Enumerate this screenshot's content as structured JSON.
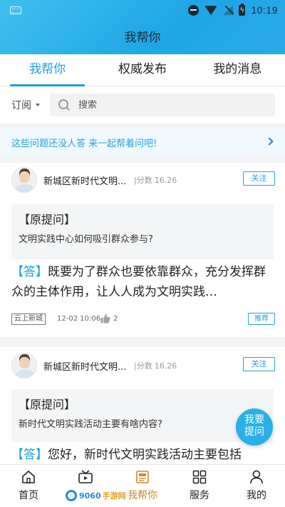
{
  "status_bar": {
    "time": "10:19"
  },
  "page_title": "我帮你",
  "tabs": [
    {
      "label": "我帮你",
      "active": true
    },
    {
      "label": "权威发布",
      "active": false
    },
    {
      "label": "我的消息",
      "active": false
    }
  ],
  "search": {
    "subscribe_label": "订阅",
    "placeholder": "搜索"
  },
  "banner": {
    "text": "这些问题还没人答 来一起帮着问吧!"
  },
  "posts": [
    {
      "author": "新城区新时代文明...",
      "score_label": "分数",
      "score": "16.26",
      "follow_label": "关注",
      "original_label": "【原提问】",
      "original_question": "文明实践中心如何吸引群众参与?",
      "answer_tag": "【答】",
      "answer_text": "既要为了群众也要依靠群众，充分发挥群众的主体作用，让人人成为文明实践…",
      "source": "云上新城",
      "time": "12-02 10:06",
      "likes": "2",
      "recommend_label": "推荐"
    },
    {
      "author": "新城区新时代文明...",
      "score_label": "分数",
      "score": "16.26",
      "follow_label": "关注",
      "original_label": "【原提问】",
      "original_question": "新时代文明实践活动主要有啥内容?",
      "answer_tag": "【答】",
      "answer_text": "您好，新时代文明实践活动主要包括"
    }
  ],
  "fab": {
    "line1": "我要",
    "line2": "提问"
  },
  "bottom_nav": [
    {
      "label": "首页",
      "icon": "home-icon",
      "active": false
    },
    {
      "label": "",
      "icon": "video-icon",
      "active": false
    },
    {
      "label": "我帮你",
      "icon": "help-icon",
      "active": true
    },
    {
      "label": "服务",
      "icon": "grid-icon",
      "active": false
    },
    {
      "label": "我的",
      "icon": "person-icon",
      "active": false
    }
  ],
  "watermark": {
    "text": "9060",
    "accent_text": "手游网"
  },
  "colors": {
    "accent": "#1ba0e2",
    "header_gradient_start": "#3fc0ef",
    "header_gradient_end": "#2aa9e8",
    "active_nav": "#c98a2a"
  }
}
